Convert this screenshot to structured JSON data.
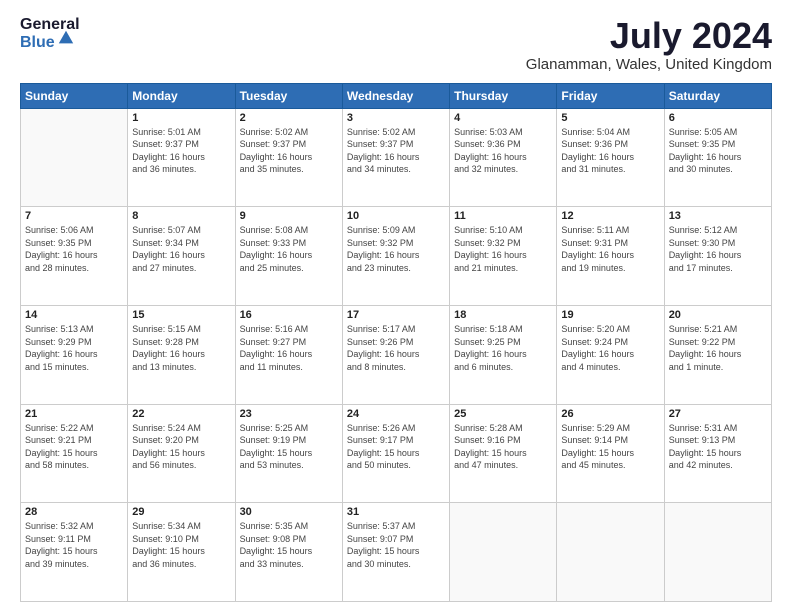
{
  "logo": {
    "general": "General",
    "blue": "Blue"
  },
  "header": {
    "month": "July 2024",
    "location": "Glanamman, Wales, United Kingdom"
  },
  "weekdays": [
    "Sunday",
    "Monday",
    "Tuesday",
    "Wednesday",
    "Thursday",
    "Friday",
    "Saturday"
  ],
  "weeks": [
    [
      {
        "day": "",
        "info": ""
      },
      {
        "day": "1",
        "info": "Sunrise: 5:01 AM\nSunset: 9:37 PM\nDaylight: 16 hours\nand 36 minutes."
      },
      {
        "day": "2",
        "info": "Sunrise: 5:02 AM\nSunset: 9:37 PM\nDaylight: 16 hours\nand 35 minutes."
      },
      {
        "day": "3",
        "info": "Sunrise: 5:02 AM\nSunset: 9:37 PM\nDaylight: 16 hours\nand 34 minutes."
      },
      {
        "day": "4",
        "info": "Sunrise: 5:03 AM\nSunset: 9:36 PM\nDaylight: 16 hours\nand 32 minutes."
      },
      {
        "day": "5",
        "info": "Sunrise: 5:04 AM\nSunset: 9:36 PM\nDaylight: 16 hours\nand 31 minutes."
      },
      {
        "day": "6",
        "info": "Sunrise: 5:05 AM\nSunset: 9:35 PM\nDaylight: 16 hours\nand 30 minutes."
      }
    ],
    [
      {
        "day": "7",
        "info": "Sunrise: 5:06 AM\nSunset: 9:35 PM\nDaylight: 16 hours\nand 28 minutes."
      },
      {
        "day": "8",
        "info": "Sunrise: 5:07 AM\nSunset: 9:34 PM\nDaylight: 16 hours\nand 27 minutes."
      },
      {
        "day": "9",
        "info": "Sunrise: 5:08 AM\nSunset: 9:33 PM\nDaylight: 16 hours\nand 25 minutes."
      },
      {
        "day": "10",
        "info": "Sunrise: 5:09 AM\nSunset: 9:32 PM\nDaylight: 16 hours\nand 23 minutes."
      },
      {
        "day": "11",
        "info": "Sunrise: 5:10 AM\nSunset: 9:32 PM\nDaylight: 16 hours\nand 21 minutes."
      },
      {
        "day": "12",
        "info": "Sunrise: 5:11 AM\nSunset: 9:31 PM\nDaylight: 16 hours\nand 19 minutes."
      },
      {
        "day": "13",
        "info": "Sunrise: 5:12 AM\nSunset: 9:30 PM\nDaylight: 16 hours\nand 17 minutes."
      }
    ],
    [
      {
        "day": "14",
        "info": "Sunrise: 5:13 AM\nSunset: 9:29 PM\nDaylight: 16 hours\nand 15 minutes."
      },
      {
        "day": "15",
        "info": "Sunrise: 5:15 AM\nSunset: 9:28 PM\nDaylight: 16 hours\nand 13 minutes."
      },
      {
        "day": "16",
        "info": "Sunrise: 5:16 AM\nSunset: 9:27 PM\nDaylight: 16 hours\nand 11 minutes."
      },
      {
        "day": "17",
        "info": "Sunrise: 5:17 AM\nSunset: 9:26 PM\nDaylight: 16 hours\nand 8 minutes."
      },
      {
        "day": "18",
        "info": "Sunrise: 5:18 AM\nSunset: 9:25 PM\nDaylight: 16 hours\nand 6 minutes."
      },
      {
        "day": "19",
        "info": "Sunrise: 5:20 AM\nSunset: 9:24 PM\nDaylight: 16 hours\nand 4 minutes."
      },
      {
        "day": "20",
        "info": "Sunrise: 5:21 AM\nSunset: 9:22 PM\nDaylight: 16 hours\nand 1 minute."
      }
    ],
    [
      {
        "day": "21",
        "info": "Sunrise: 5:22 AM\nSunset: 9:21 PM\nDaylight: 15 hours\nand 58 minutes."
      },
      {
        "day": "22",
        "info": "Sunrise: 5:24 AM\nSunset: 9:20 PM\nDaylight: 15 hours\nand 56 minutes."
      },
      {
        "day": "23",
        "info": "Sunrise: 5:25 AM\nSunset: 9:19 PM\nDaylight: 15 hours\nand 53 minutes."
      },
      {
        "day": "24",
        "info": "Sunrise: 5:26 AM\nSunset: 9:17 PM\nDaylight: 15 hours\nand 50 minutes."
      },
      {
        "day": "25",
        "info": "Sunrise: 5:28 AM\nSunset: 9:16 PM\nDaylight: 15 hours\nand 47 minutes."
      },
      {
        "day": "26",
        "info": "Sunrise: 5:29 AM\nSunset: 9:14 PM\nDaylight: 15 hours\nand 45 minutes."
      },
      {
        "day": "27",
        "info": "Sunrise: 5:31 AM\nSunset: 9:13 PM\nDaylight: 15 hours\nand 42 minutes."
      }
    ],
    [
      {
        "day": "28",
        "info": "Sunrise: 5:32 AM\nSunset: 9:11 PM\nDaylight: 15 hours\nand 39 minutes."
      },
      {
        "day": "29",
        "info": "Sunrise: 5:34 AM\nSunset: 9:10 PM\nDaylight: 15 hours\nand 36 minutes."
      },
      {
        "day": "30",
        "info": "Sunrise: 5:35 AM\nSunset: 9:08 PM\nDaylight: 15 hours\nand 33 minutes."
      },
      {
        "day": "31",
        "info": "Sunrise: 5:37 AM\nSunset: 9:07 PM\nDaylight: 15 hours\nand 30 minutes."
      },
      {
        "day": "",
        "info": ""
      },
      {
        "day": "",
        "info": ""
      },
      {
        "day": "",
        "info": ""
      }
    ]
  ]
}
